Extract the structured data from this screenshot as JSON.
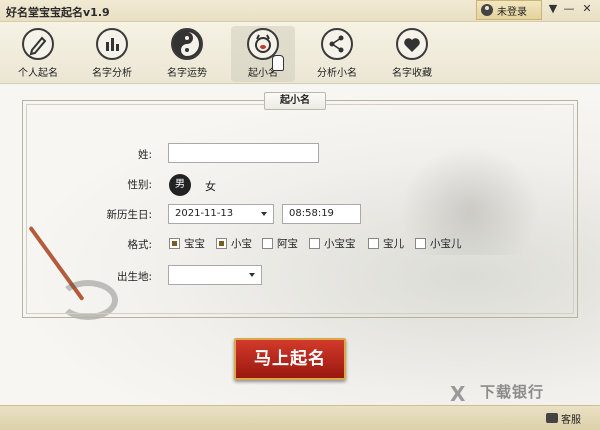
{
  "app": {
    "title": "好名堂宝宝起名v1.9"
  },
  "titlebar": {
    "login_label": "未登录",
    "menu_glyph": "▼",
    "minimize_glyph": "—",
    "close_glyph": "✕"
  },
  "toolbar": {
    "items": [
      {
        "label": "个人起名",
        "icon": "pen-icon"
      },
      {
        "label": "名字分析",
        "icon": "bar-chart-icon"
      },
      {
        "label": "名字运势",
        "icon": "yin-yang-icon"
      },
      {
        "label": "起小名",
        "icon": "pig-face-icon",
        "active": true
      },
      {
        "label": "分析小名",
        "icon": "share-icon"
      },
      {
        "label": "名字收藏",
        "icon": "heart-icon"
      }
    ]
  },
  "form": {
    "section_title": "起小名",
    "surname_label": "姓:",
    "surname_value": "",
    "gender_label": "性别:",
    "gender_selected": "男",
    "gender_other": "女",
    "birthday_label": "新历生日:",
    "birth_date": "2021-11-13",
    "birth_time": "08:58:19",
    "format_label": "格式:",
    "formats": [
      {
        "label": "宝宝",
        "checked": true
      },
      {
        "label": "小宝",
        "checked": true
      },
      {
        "label": "阿宝",
        "checked": false
      },
      {
        "label": "小宝宝",
        "checked": false
      },
      {
        "label": "宝儿",
        "checked": false
      },
      {
        "label": "小宝儿",
        "checked": false
      }
    ],
    "birthplace_label": "出生地:",
    "birthplace_value": "",
    "submit_label": "马上起名"
  },
  "watermark": {
    "logo": "X",
    "text": "下载银行"
  },
  "statusbar": {
    "service_label": "客服"
  },
  "colors": {
    "accent_red": "#b8231a",
    "gold_border": "#d9a94c",
    "titlebar_bg": "#ebe2c6"
  }
}
